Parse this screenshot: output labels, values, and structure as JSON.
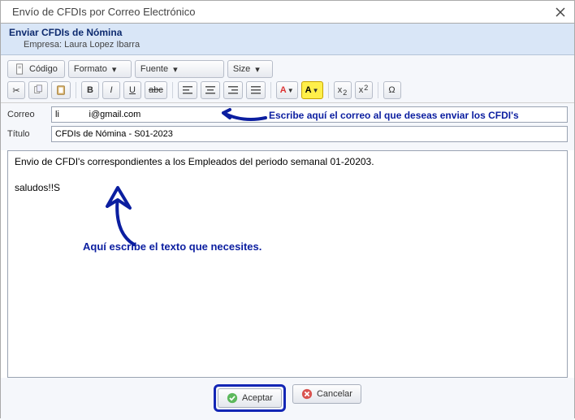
{
  "window": {
    "title": "Envío de CFDIs por Correo Electrónico"
  },
  "subheader": {
    "heading": "Enviar CFDIs de Nómina",
    "company_prefix": "Empresa:",
    "company_name": "Laura Lopez Ibarra"
  },
  "toolbar": {
    "source_label": "Código",
    "format_label": "Formato",
    "font_label": "Fuente",
    "size_label": "Size",
    "bold": "B",
    "italic": "I",
    "underline": "U",
    "strike": "abc",
    "fontcolor": "A",
    "bgcolor": "A",
    "sub": "x",
    "sub2": "2",
    "sup": "x",
    "sup2": "2",
    "omega": "Ω"
  },
  "fields": {
    "correo_label": "Correo",
    "correo_value": "li            i@gmail.com",
    "titulo_label": "Título",
    "titulo_value": "CFDIs de Nómina - S01-2023"
  },
  "editor": {
    "line1": "Envio de CFDI's correspondientes a los Empleados del periodo semanal 01-20203.",
    "line2": "saludos!!S"
  },
  "annotations": {
    "correo": "Escribe aquí el correo al que deseas enviar los CFDI's",
    "body": "Aquí escribe el texto que necesites."
  },
  "footer": {
    "accept": "Aceptar",
    "cancel": "Cancelar"
  }
}
